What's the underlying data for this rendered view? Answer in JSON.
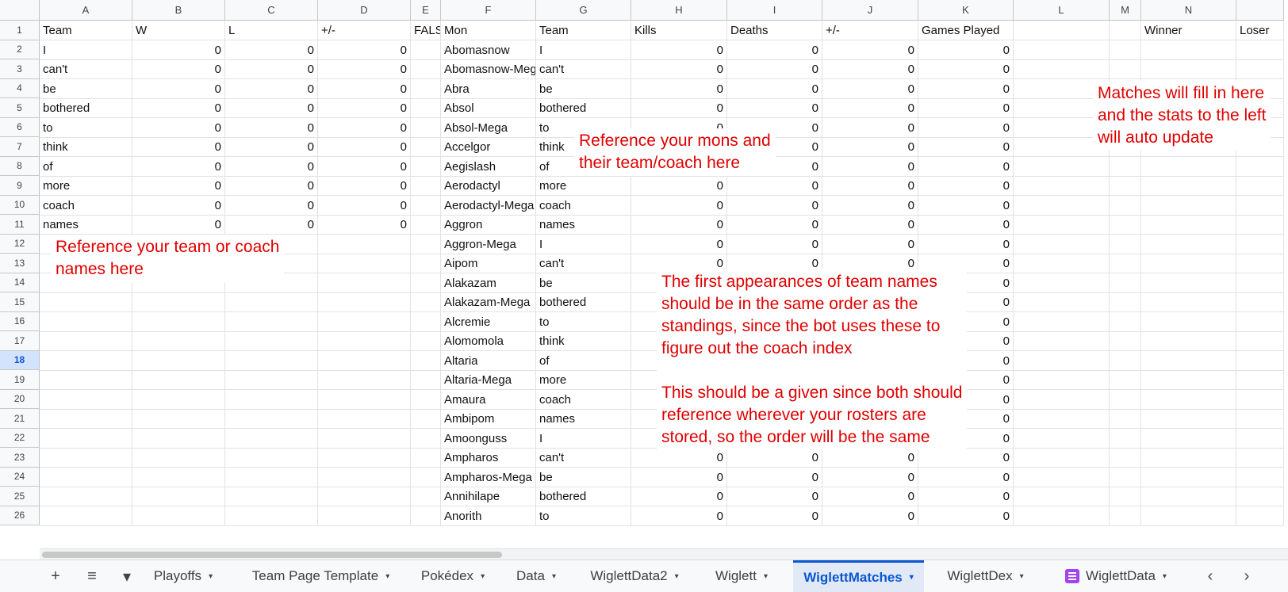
{
  "columns": [
    {
      "letter": "A",
      "width": 117
    },
    {
      "letter": "B",
      "width": 117
    },
    {
      "letter": "C",
      "width": 117
    },
    {
      "letter": "D",
      "width": 117
    },
    {
      "letter": "E",
      "width": 38
    },
    {
      "letter": "F",
      "width": 120
    },
    {
      "letter": "G",
      "width": 120
    },
    {
      "letter": "H",
      "width": 121
    },
    {
      "letter": "I",
      "width": 120
    },
    {
      "letter": "J",
      "width": 121
    },
    {
      "letter": "K",
      "width": 120
    },
    {
      "letter": "L",
      "width": 121
    },
    {
      "letter": "M",
      "width": 40
    },
    {
      "letter": "N",
      "width": 120
    },
    {
      "letter": "",
      "width": 60
    }
  ],
  "selected_row": 18,
  "rows": [
    {
      "num": "1",
      "cells": [
        "Team",
        "W",
        "L",
        "+/-",
        "FALSE",
        "Mon",
        "Team",
        "Kills",
        "Deaths",
        "+/-",
        "Games Played",
        "",
        "",
        "Winner",
        "Loser"
      ]
    },
    {
      "num": "2",
      "cells": [
        "I",
        "0",
        "0",
        "0",
        "",
        "Abomasnow",
        "I",
        "0",
        "0",
        "0",
        "0",
        "",
        "",
        "",
        ""
      ]
    },
    {
      "num": "3",
      "cells": [
        "can't",
        "0",
        "0",
        "0",
        "",
        "Abomasnow-Mega",
        "can't",
        "0",
        "0",
        "0",
        "0",
        "",
        "",
        "",
        ""
      ]
    },
    {
      "num": "4",
      "cells": [
        "be",
        "0",
        "0",
        "0",
        "",
        "Abra",
        "be",
        "0",
        "0",
        "0",
        "0",
        "",
        "",
        "",
        ""
      ]
    },
    {
      "num": "5",
      "cells": [
        "bothered",
        "0",
        "0",
        "0",
        "",
        "Absol",
        "bothered",
        "0",
        "0",
        "0",
        "0",
        "",
        "",
        "",
        ""
      ]
    },
    {
      "num": "6",
      "cells": [
        "to",
        "0",
        "0",
        "0",
        "",
        "Absol-Mega",
        "to",
        "0",
        "0",
        "0",
        "0",
        "",
        "",
        "",
        ""
      ]
    },
    {
      "num": "7",
      "cells": [
        "think",
        "0",
        "0",
        "0",
        "",
        "Accelgor",
        "think",
        "0",
        "0",
        "0",
        "0",
        "",
        "",
        "",
        ""
      ]
    },
    {
      "num": "8",
      "cells": [
        "of",
        "0",
        "0",
        "0",
        "",
        "Aegislash",
        "of",
        "0",
        "0",
        "0",
        "0",
        "",
        "",
        "",
        ""
      ]
    },
    {
      "num": "9",
      "cells": [
        "more",
        "0",
        "0",
        "0",
        "",
        "Aerodactyl",
        "more",
        "0",
        "0",
        "0",
        "0",
        "",
        "",
        "",
        ""
      ]
    },
    {
      "num": "10",
      "cells": [
        "coach",
        "0",
        "0",
        "0",
        "",
        "Aerodactyl-Mega",
        "coach",
        "0",
        "0",
        "0",
        "0",
        "",
        "",
        "",
        ""
      ]
    },
    {
      "num": "11",
      "cells": [
        "names",
        "0",
        "0",
        "0",
        "",
        "Aggron",
        "names",
        "0",
        "0",
        "0",
        "0",
        "",
        "",
        "",
        ""
      ]
    },
    {
      "num": "12",
      "cells": [
        "",
        "",
        "",
        "",
        "",
        "Aggron-Mega",
        "I",
        "0",
        "0",
        "0",
        "0",
        "",
        "",
        "",
        ""
      ]
    },
    {
      "num": "13",
      "cells": [
        "",
        "",
        "",
        "",
        "",
        "Aipom",
        "can't",
        "0",
        "0",
        "0",
        "0",
        "",
        "",
        "",
        ""
      ]
    },
    {
      "num": "14",
      "cells": [
        "",
        "",
        "",
        "",
        "",
        "Alakazam",
        "be",
        "0",
        "0",
        "0",
        "0",
        "",
        "",
        "",
        ""
      ]
    },
    {
      "num": "15",
      "cells": [
        "",
        "",
        "",
        "",
        "",
        "Alakazam-Mega",
        "bothered",
        "0",
        "0",
        "0",
        "0",
        "",
        "",
        "",
        ""
      ]
    },
    {
      "num": "16",
      "cells": [
        "",
        "",
        "",
        "",
        "",
        "Alcremie",
        "to",
        "0",
        "0",
        "0",
        "0",
        "",
        "",
        "",
        ""
      ]
    },
    {
      "num": "17",
      "cells": [
        "",
        "",
        "",
        "",
        "",
        "Alomomola",
        "think",
        "0",
        "0",
        "0",
        "0",
        "",
        "",
        "",
        ""
      ]
    },
    {
      "num": "18",
      "cells": [
        "",
        "",
        "",
        "",
        "",
        "Altaria",
        "of",
        "0",
        "0",
        "0",
        "0",
        "",
        "",
        "",
        ""
      ]
    },
    {
      "num": "19",
      "cells": [
        "",
        "",
        "",
        "",
        "",
        "Altaria-Mega",
        "more",
        "0",
        "0",
        "0",
        "0",
        "",
        "",
        "",
        ""
      ]
    },
    {
      "num": "20",
      "cells": [
        "",
        "",
        "",
        "",
        "",
        "Amaura",
        "coach",
        "0",
        "0",
        "0",
        "0",
        "",
        "",
        "",
        ""
      ]
    },
    {
      "num": "21",
      "cells": [
        "",
        "",
        "",
        "",
        "",
        "Ambipom",
        "names",
        "0",
        "0",
        "0",
        "0",
        "",
        "",
        "",
        ""
      ]
    },
    {
      "num": "22",
      "cells": [
        "",
        "",
        "",
        "",
        "",
        "Amoonguss",
        "I",
        "0",
        "0",
        "0",
        "0",
        "",
        "",
        "",
        ""
      ]
    },
    {
      "num": "23",
      "cells": [
        "",
        "",
        "",
        "",
        "",
        "Ampharos",
        "can't",
        "0",
        "0",
        "0",
        "0",
        "",
        "",
        "",
        ""
      ]
    },
    {
      "num": "24",
      "cells": [
        "",
        "",
        "",
        "",
        "",
        "Ampharos-Mega",
        "be",
        "0",
        "0",
        "0",
        "0",
        "",
        "",
        "",
        ""
      ]
    },
    {
      "num": "25",
      "cells": [
        "",
        "",
        "",
        "",
        "",
        "Annihilape",
        "bothered",
        "0",
        "0",
        "0",
        "0",
        "",
        "",
        "",
        ""
      ]
    },
    {
      "num": "26",
      "cells": [
        "",
        "",
        "",
        "",
        "",
        "Anorith",
        "to",
        "0",
        "0",
        "0",
        "0",
        "",
        "",
        "",
        ""
      ]
    }
  ],
  "notes": {
    "teams": [
      "Reference your team or coach",
      "names here"
    ],
    "mons": [
      "Reference your mons and",
      "their team/coach here"
    ],
    "matches": [
      "Matches will fill in here",
      "and the stats to the left",
      "will auto update"
    ],
    "order": [
      "The first appearances of team names",
      "should be in the same order as the",
      "standings, since the bot uses these to",
      "figure out the coach index",
      "",
      "This should be a given since both should",
      "reference wherever your rosters are",
      "stored, so the order will be the same"
    ]
  },
  "tabbar": {
    "add_icon": "+",
    "menu_icon": "≡",
    "dropdown_icon": "▾",
    "prev_icon": "‹",
    "next_icon": "›",
    "tabs": [
      {
        "label": "Playoffs",
        "active": false,
        "icon": ""
      },
      {
        "label": "Team Page Template",
        "active": false,
        "icon": ""
      },
      {
        "label": "Pokédex",
        "active": false,
        "icon": ""
      },
      {
        "label": "Data",
        "active": false,
        "icon": ""
      },
      {
        "label": "WiglettData2",
        "active": false,
        "icon": ""
      },
      {
        "label": "Wiglett",
        "active": false,
        "icon": ""
      },
      {
        "label": "WiglettMatches",
        "active": true,
        "icon": ""
      },
      {
        "label": "WiglettDex",
        "active": false,
        "icon": ""
      },
      {
        "label": "WiglettData",
        "active": false,
        "icon": "table-sheet-icon"
      }
    ]
  },
  "colors": {
    "note_text": "#e00000",
    "active_tab": "#0b57d0",
    "sheet_icon": "#a142f4"
  }
}
